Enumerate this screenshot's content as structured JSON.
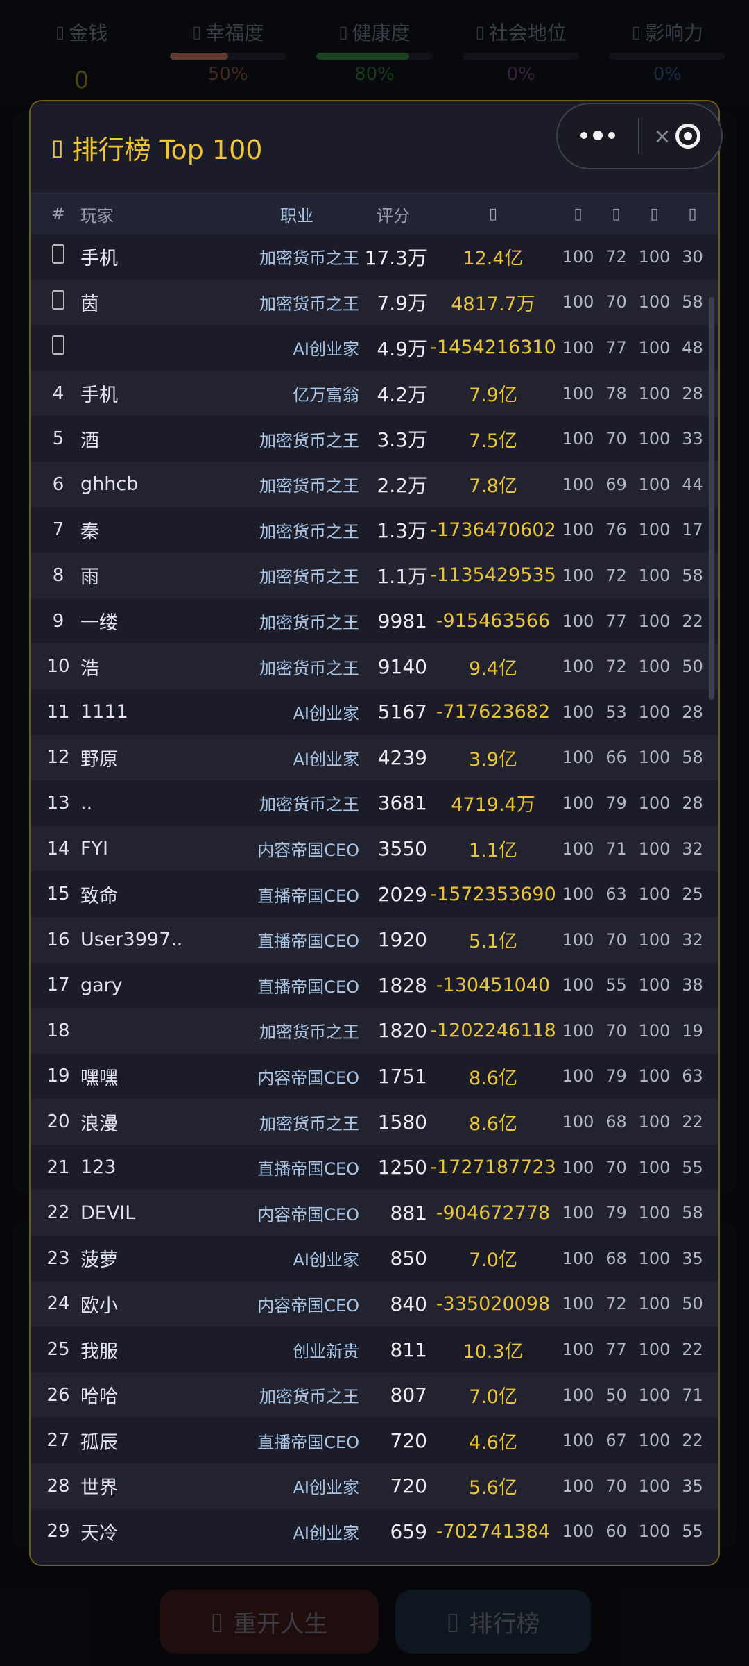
{
  "stats": [
    {
      "label": "金钱",
      "icon": "coin-icon",
      "value": "0",
      "type": "value"
    },
    {
      "label": "幸福度",
      "icon": "smile-icon",
      "percent": "50%",
      "fill": 0.5,
      "color": "#b06a52",
      "pct_color": "#7a4638"
    },
    {
      "label": "健康度",
      "icon": "heart-icon",
      "percent": "80%",
      "fill": 0.8,
      "color": "#2e7a3a",
      "pct_color": "#2f6a36"
    },
    {
      "label": "社会地位",
      "icon": "crown-icon",
      "percent": "0%",
      "fill": 0.0,
      "color": "#7a3a7a",
      "pct_color": "#6a3a6e"
    },
    {
      "label": "影响力",
      "icon": "star-icon",
      "percent": "0%",
      "fill": 0.0,
      "color": "#2a5a8a",
      "pct_color": "#2e5580"
    }
  ],
  "modal": {
    "title": "排行榜 Top 100",
    "columns": {
      "rank": "#",
      "name": "玩家",
      "job": "职业",
      "score": "评分",
      "money": "",
      "n1": "",
      "n2": "",
      "n3": "",
      "n4": ""
    }
  },
  "rows": [
    {
      "rank": "",
      "name": "手机",
      "job": "加密货币之王",
      "score": "17.3万",
      "money": "12.4亿",
      "a": "100",
      "b": "72",
      "c": "100",
      "d": "30"
    },
    {
      "rank": "",
      "name": "茵",
      "job": "加密货币之王",
      "score": "7.9万",
      "money": "4817.7万",
      "a": "100",
      "b": "70",
      "c": "100",
      "d": "58"
    },
    {
      "rank": "",
      "name": "",
      "job": "AI创业家",
      "score": "4.9万",
      "money": "-1454216310",
      "a": "100",
      "b": "77",
      "c": "100",
      "d": "48"
    },
    {
      "rank": "4",
      "name": "手机",
      "job": "亿万富翁",
      "score": "4.2万",
      "money": "7.9亿",
      "a": "100",
      "b": "78",
      "c": "100",
      "d": "28"
    },
    {
      "rank": "5",
      "name": "酒",
      "job": "加密货币之王",
      "score": "3.3万",
      "money": "7.5亿",
      "a": "100",
      "b": "70",
      "c": "100",
      "d": "33"
    },
    {
      "rank": "6",
      "name": "ghhcb",
      "job": "加密货币之王",
      "score": "2.2万",
      "money": "7.8亿",
      "a": "100",
      "b": "69",
      "c": "100",
      "d": "44"
    },
    {
      "rank": "7",
      "name": "秦",
      "job": "加密货币之王",
      "score": "1.3万",
      "money": "-1736470602",
      "a": "100",
      "b": "76",
      "c": "100",
      "d": "17"
    },
    {
      "rank": "8",
      "name": "雨",
      "job": "加密货币之王",
      "score": "1.1万",
      "money": "-1135429535",
      "a": "100",
      "b": "72",
      "c": "100",
      "d": "58"
    },
    {
      "rank": "9",
      "name": "一缕",
      "job": "加密货币之王",
      "score": "9981",
      "money": "-915463566",
      "a": "100",
      "b": "77",
      "c": "100",
      "d": "22"
    },
    {
      "rank": "10",
      "name": "浩",
      "job": "加密货币之王",
      "score": "9140",
      "money": "9.4亿",
      "a": "100",
      "b": "72",
      "c": "100",
      "d": "50"
    },
    {
      "rank": "11",
      "name": "1111",
      "job": "AI创业家",
      "score": "5167",
      "money": "-717623682",
      "a": "100",
      "b": "53",
      "c": "100",
      "d": "28"
    },
    {
      "rank": "12",
      "name": "野原",
      "job": "AI创业家",
      "score": "4239",
      "money": "3.9亿",
      "a": "100",
      "b": "66",
      "c": "100",
      "d": "58"
    },
    {
      "rank": "13",
      "name": "..",
      "job": "加密货币之王",
      "score": "3681",
      "money": "4719.4万",
      "a": "100",
      "b": "79",
      "c": "100",
      "d": "28"
    },
    {
      "rank": "14",
      "name": "FYI",
      "job": "内容帝国CEO",
      "score": "3550",
      "money": "1.1亿",
      "a": "100",
      "b": "71",
      "c": "100",
      "d": "32"
    },
    {
      "rank": "15",
      "name": "致命",
      "job": "直播帝国CEO",
      "score": "2029",
      "money": "-1572353690",
      "a": "100",
      "b": "63",
      "c": "100",
      "d": "25"
    },
    {
      "rank": "16",
      "name": "User3997..",
      "job": "直播帝国CEO",
      "score": "1920",
      "money": "5.1亿",
      "a": "100",
      "b": "70",
      "c": "100",
      "d": "32"
    },
    {
      "rank": "17",
      "name": "gary",
      "job": "直播帝国CEO",
      "score": "1828",
      "money": "-130451040",
      "a": "100",
      "b": "55",
      "c": "100",
      "d": "38"
    },
    {
      "rank": "18",
      "name": "",
      "job": "加密货币之王",
      "score": "1820",
      "money": "-1202246118",
      "a": "100",
      "b": "70",
      "c": "100",
      "d": "19"
    },
    {
      "rank": "19",
      "name": "嘿嘿",
      "job": "内容帝国CEO",
      "score": "1751",
      "money": "8.6亿",
      "a": "100",
      "b": "79",
      "c": "100",
      "d": "63"
    },
    {
      "rank": "20",
      "name": "浪漫",
      "job": "加密货币之王",
      "score": "1580",
      "money": "8.6亿",
      "a": "100",
      "b": "68",
      "c": "100",
      "d": "22"
    },
    {
      "rank": "21",
      "name": "123",
      "job": "直播帝国CEO",
      "score": "1250",
      "money": "-1727187723",
      "a": "100",
      "b": "70",
      "c": "100",
      "d": "55"
    },
    {
      "rank": "22",
      "name": "DEVIL",
      "job": "内容帝国CEO",
      "score": "881",
      "money": "-904672778",
      "a": "100",
      "b": "79",
      "c": "100",
      "d": "58"
    },
    {
      "rank": "23",
      "name": "菠萝",
      "job": "AI创业家",
      "score": "850",
      "money": "7.0亿",
      "a": "100",
      "b": "68",
      "c": "100",
      "d": "35"
    },
    {
      "rank": "24",
      "name": "欧小",
      "job": "内容帝国CEO",
      "score": "840",
      "money": "-335020098",
      "a": "100",
      "b": "72",
      "c": "100",
      "d": "50"
    },
    {
      "rank": "25",
      "name": "我服",
      "job": "创业新贵",
      "score": "811",
      "money": "10.3亿",
      "a": "100",
      "b": "77",
      "c": "100",
      "d": "22"
    },
    {
      "rank": "26",
      "name": "哈哈",
      "job": "加密货币之王",
      "score": "807",
      "money": "7.0亿",
      "a": "100",
      "b": "50",
      "c": "100",
      "d": "71"
    },
    {
      "rank": "27",
      "name": "孤辰",
      "job": "直播帝国CEO",
      "score": "720",
      "money": "4.6亿",
      "a": "100",
      "b": "67",
      "c": "100",
      "d": "22"
    },
    {
      "rank": "28",
      "name": "世界",
      "job": "AI创业家",
      "score": "720",
      "money": "5.6亿",
      "a": "100",
      "b": "70",
      "c": "100",
      "d": "35"
    },
    {
      "rank": "29",
      "name": "天冷",
      "job": "AI创业家",
      "score": "659",
      "money": "-702741384",
      "a": "100",
      "b": "60",
      "c": "100",
      "d": "55"
    }
  ],
  "buttons": {
    "restart": "重开人生",
    "leaderboard": "排行榜"
  }
}
